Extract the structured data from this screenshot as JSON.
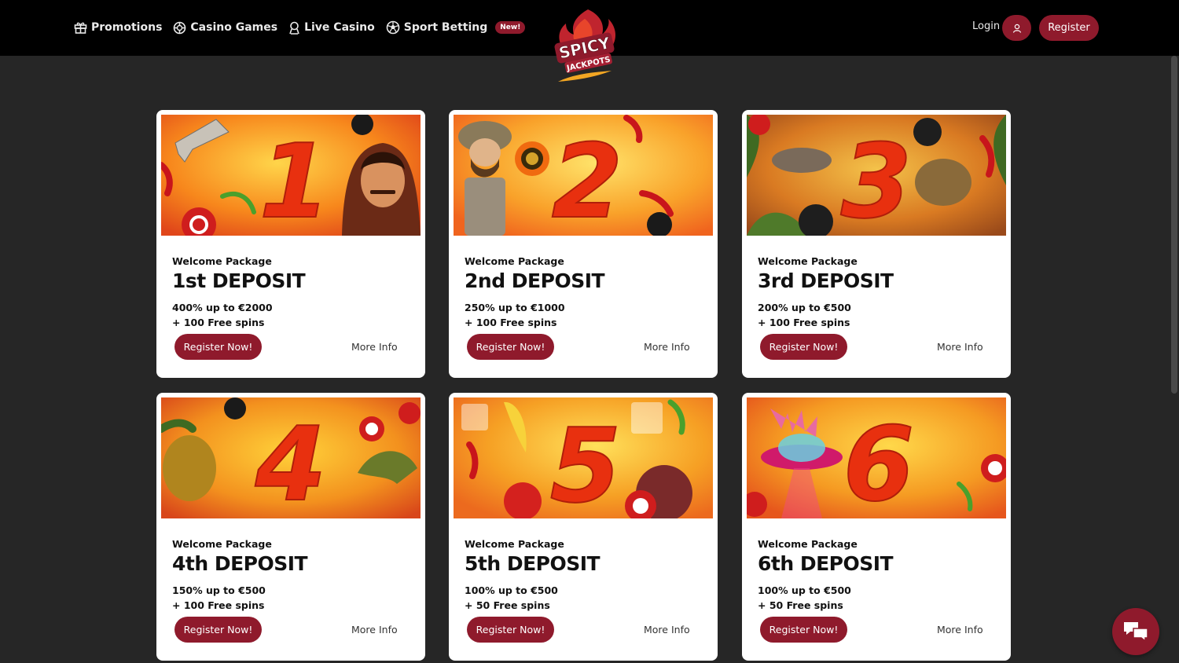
{
  "header": {
    "nav": [
      {
        "label": "Promotions",
        "icon": "gift-icon"
      },
      {
        "label": "Casino Games",
        "icon": "chip-icon"
      },
      {
        "label": "Live Casino",
        "icon": "dealer-icon"
      },
      {
        "label": "Sport Betting",
        "icon": "football-icon"
      }
    ],
    "new_badge": "New!",
    "logo_text_top": "SPICY",
    "logo_text_bottom": "JACKPOTS",
    "login_label": "Login",
    "register_label": "Register"
  },
  "colors": {
    "accent": "#8f1a2c",
    "page_bg": "#262626",
    "header_bg": "#000000"
  },
  "cards": [
    {
      "subtitle": "Welcome Package",
      "title": "1st DEPOSIT",
      "line1": "400% up to €2000",
      "line2": "+ 100 Free spins",
      "cta": "Register Now!",
      "more": "More Info",
      "digit": "1"
    },
    {
      "subtitle": "Welcome Package",
      "title": "2nd DEPOSIT",
      "line1": "250% up to €1000",
      "line2": "+ 100 Free spins",
      "cta": "Register Now!",
      "more": "More Info",
      "digit": "2"
    },
    {
      "subtitle": "Welcome Package",
      "title": "3rd DEPOSIT",
      "line1": "200% up to €500",
      "line2": "+ 100 Free spins",
      "cta": "Register Now!",
      "more": "More Info",
      "digit": "3"
    },
    {
      "subtitle": "Welcome Package",
      "title": "4th DEPOSIT",
      "line1": "150% up to €500",
      "line2": "+ 100 Free spins",
      "cta": "Register Now!",
      "more": "More Info",
      "digit": "4"
    },
    {
      "subtitle": "Welcome Package",
      "title": "5th DEPOSIT",
      "line1": "100% up to €500",
      "line2": "+ 50 Free spins",
      "cta": "Register Now!",
      "more": "More Info",
      "digit": "5"
    },
    {
      "subtitle": "Welcome Package",
      "title": "6th DEPOSIT",
      "line1": "100% up to €500",
      "line2": "+ 50 Free spins",
      "cta": "Register Now!",
      "more": "More Info",
      "digit": "6"
    }
  ]
}
